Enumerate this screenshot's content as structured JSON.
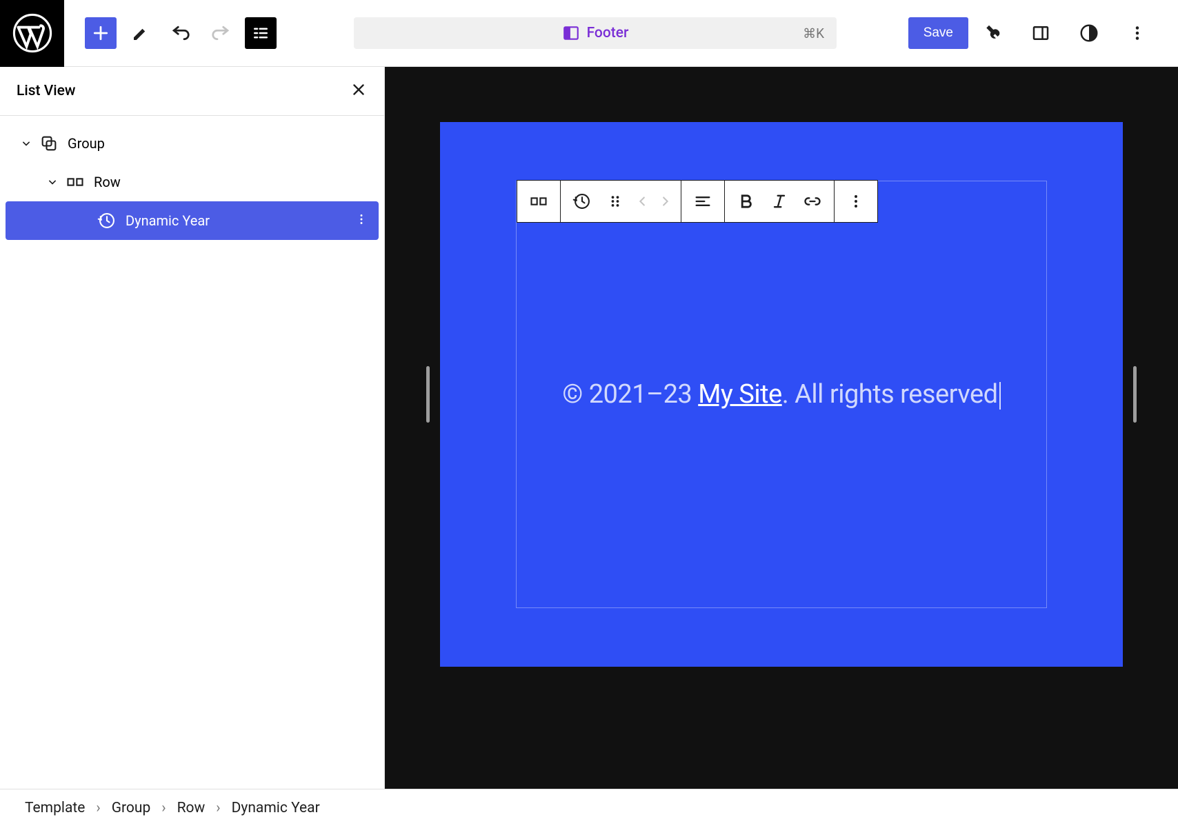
{
  "toolbar": {
    "save_label": "Save",
    "center_label": "Footer",
    "center_kbd": "⌘K"
  },
  "sidebar": {
    "title": "List View",
    "items": [
      {
        "label": "Group"
      },
      {
        "label": "Row"
      },
      {
        "label": "Dynamic Year"
      }
    ]
  },
  "canvas": {
    "copyright_prefix": "© 2021–23 ",
    "site_name": "My Site",
    "copyright_suffix": ". All rights reserved"
  },
  "breadcrumb": {
    "items": [
      "Template",
      "Group",
      "Row",
      "Dynamic Year"
    ]
  }
}
